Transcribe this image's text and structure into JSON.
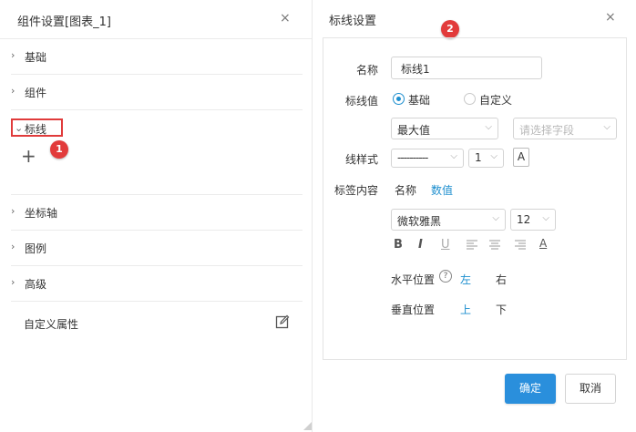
{
  "left_panel": {
    "title": "组件设置[图表_1]",
    "close": "×",
    "sections": [
      {
        "label": "基础",
        "chevron": "›"
      },
      {
        "label": "组件",
        "chevron": "›"
      }
    ],
    "markline": {
      "label": "标线",
      "chevron": "⌄",
      "add": "+"
    },
    "more_sections": [
      {
        "label": "坐标轴",
        "chevron": "›"
      },
      {
        "label": "图例",
        "chevron": "›"
      },
      {
        "label": "高级",
        "chevron": "›"
      }
    ],
    "custom_attr": "自定义属性",
    "badge": "1"
  },
  "dialog": {
    "title": "标线设置",
    "close": "×",
    "badge": "2",
    "name_label": "名称",
    "name_value": "标线1",
    "value_label": "标线值",
    "radio_basic": "基础",
    "radio_custom": "自定义",
    "value_select": "最大值",
    "field_select_placeholder": "请选择字段",
    "style_label": "线样式",
    "line_dash": "----------",
    "line_width": "1",
    "color_button": "A",
    "content_label": "标签内容",
    "content_opt_name": "名称",
    "content_opt_value": "数值",
    "font_family": "微软雅黑",
    "font_size": "12",
    "fmt_bold": "B",
    "fmt_italic": "I",
    "fmt_underline": "U",
    "fmt_color": "A",
    "h_pos_label": "水平位置",
    "h_help": "?",
    "h_left": "左",
    "h_right": "右",
    "v_pos_label": "垂直位置",
    "v_top": "上",
    "v_bottom": "下",
    "ok": "确定",
    "cancel": "取消",
    "colors": {
      "accent": "#1e8fcf",
      "primary_button": "#2a8fdc",
      "badge": "#e23b3b",
      "highlight_border": "#e03b3b"
    }
  }
}
